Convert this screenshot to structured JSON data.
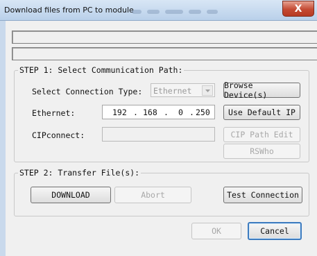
{
  "window": {
    "title": "Download files from PC to module",
    "close_glyph": "X",
    "icons": {
      "close": "close-icon",
      "combo_arrow": "chevron-down-icon"
    }
  },
  "status": {
    "line1": "",
    "line2": ""
  },
  "step1": {
    "legend": "STEP 1: Select Communication Path:",
    "connection_type_label": "Select Connection Type:",
    "connection_type_value": "Ethernet",
    "ethernet_label": "Ethernet:",
    "ip": {
      "o1": "192",
      "o2": "168",
      "o3": "0",
      "o4": "250",
      "sep": "."
    },
    "cipconnect_label": "CIPconnect:",
    "cipconnect_value": "",
    "browse_label": "Browse Device(s)",
    "use_default_ip_label": "Use Default IP",
    "cip_path_edit_label": "CIP Path Edit",
    "rswho_label": "RSWho"
  },
  "step2": {
    "legend": "STEP 2: Transfer File(s):",
    "download_label": "DOWNLOAD",
    "abort_label": "Abort",
    "test_connection_label": "Test Connection"
  },
  "footer": {
    "ok_label": "OK",
    "cancel_label": "Cancel"
  }
}
